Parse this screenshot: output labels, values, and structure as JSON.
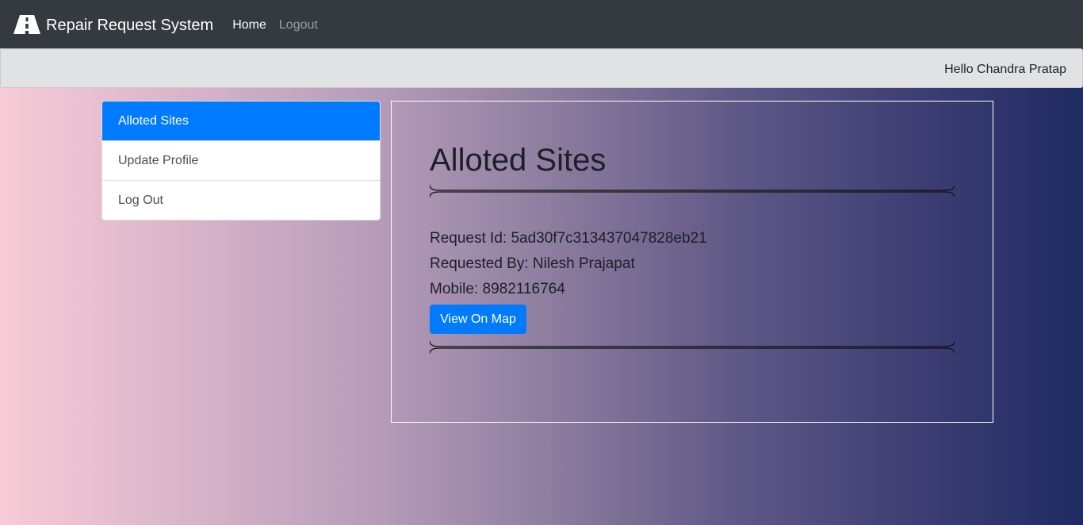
{
  "navbar": {
    "brand": "Repair Request System",
    "brand_icon": "road-icon",
    "links": [
      {
        "label": "Home"
      },
      {
        "label": "Logout"
      }
    ]
  },
  "greeting_bar": {
    "text": "Hello Chandra Pratap"
  },
  "sidebar": {
    "items": [
      {
        "label": "Alloted Sites",
        "active": true
      },
      {
        "label": "Update Profile",
        "active": false
      },
      {
        "label": "Log Out",
        "active": false
      }
    ]
  },
  "main": {
    "title": "Alloted Sites",
    "request": {
      "id_line": "Request Id: 5ad30f7c313437047828eb21",
      "requested_by_line": "Requested By: Nilesh Prajapat",
      "mobile_line": "Mobile: 8982116764",
      "button_label": "View On Map"
    }
  },
  "colors": {
    "navbar_bg": "#343a40",
    "primary": "#007bff",
    "greeting_bar_bg": "#e1e2e4"
  }
}
